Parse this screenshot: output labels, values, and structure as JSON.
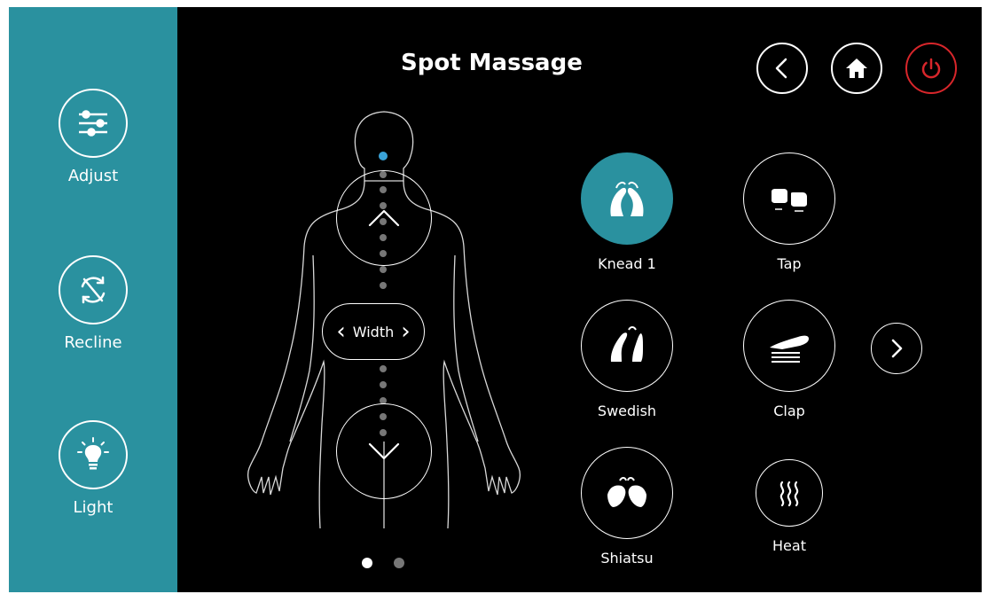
{
  "header": {
    "title": "Spot Massage"
  },
  "sidebar": {
    "items": [
      {
        "label": "Adjust",
        "icon": "sliders-icon"
      },
      {
        "label": "Recline",
        "icon": "recline-arrows-icon"
      },
      {
        "label": "Light",
        "icon": "lightbulb-icon"
      }
    ]
  },
  "top_controls": [
    {
      "name": "back-button",
      "icon": "chevron-left-icon"
    },
    {
      "name": "home-button",
      "icon": "home-icon"
    },
    {
      "name": "power-button",
      "icon": "power-icon"
    }
  ],
  "body_map": {
    "width_label": "Width",
    "point_count": 18,
    "active_point": 1
  },
  "modes": [
    {
      "label": "Knead 1",
      "icon": "knead-hands-icon",
      "active": true
    },
    {
      "label": "Tap",
      "icon": "tap-fists-icon",
      "active": false
    },
    {
      "label": "Swedish",
      "icon": "swedish-hands-icon",
      "active": false
    },
    {
      "label": "Clap",
      "icon": "clap-hand-icon",
      "active": false
    },
    {
      "label": "Shiatsu",
      "icon": "shiatsu-hands-icon",
      "active": false
    },
    {
      "label": "Heat",
      "icon": "heat-waves-icon",
      "active": false
    }
  ],
  "pagination": {
    "pages": 2,
    "current": 1
  },
  "colors": {
    "accent": "#2a919f",
    "power": "#d8262b",
    "active_point": "#3aa3d8",
    "inactive_dot": "#777777"
  }
}
